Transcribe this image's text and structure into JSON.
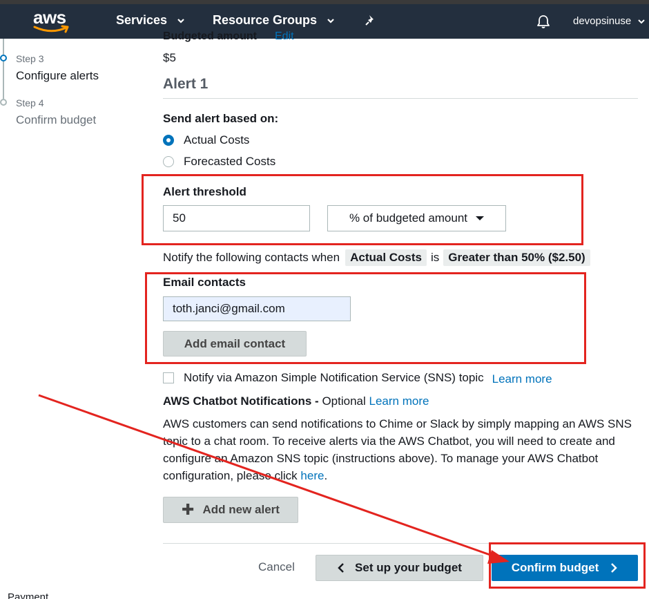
{
  "topnav": {
    "logo": "aws",
    "services_label": "Services",
    "resource_groups_label": "Resource Groups",
    "username": "devopsinuse",
    "icons": [
      "chevron-down-icon",
      "pin-icon",
      "bell-icon"
    ],
    "background_color": "#232f3e"
  },
  "steps": [
    {
      "label": "Step 3",
      "title": "Configure alerts",
      "state": "active"
    },
    {
      "label": "Step 4",
      "title": "Confirm budget",
      "state": "pending"
    }
  ],
  "sidebar_footer": "Payment",
  "budget": {
    "amount_label": "Budgeted amount",
    "edit_link": "Edit",
    "amount_value": "$5"
  },
  "alert": {
    "heading": "Alert 1",
    "send_based_on_label": "Send alert based on:",
    "options": [
      {
        "label": "Actual Costs",
        "checked": true
      },
      {
        "label": "Forecasted Costs",
        "checked": false
      }
    ],
    "threshold_label": "Alert threshold",
    "threshold_value": "50",
    "threshold_unit": "% of budgeted amount",
    "notify_prefix": "Notify the following contacts when",
    "notify_chip_1": "Actual Costs",
    "notify_mid": "is",
    "notify_chip_2": "Greater than 50% ($2.50)",
    "email_label": "Email contacts",
    "email_value": "toth.janci@gmail.com",
    "add_email_label": "Add email contact",
    "sns_label": "Notify via Amazon Simple Notification Service (SNS) topic",
    "sns_learn_more": "Learn more",
    "chatbot_title": "AWS Chatbot Notifications -",
    "chatbot_optional": "Optional",
    "chatbot_learn_more": "Learn more",
    "chatbot_text": "AWS customers can send notifications to Chime or Slack by simply mapping an AWS SNS topic to a chat room. To receive alerts via the AWS Chatbot, you will need to create and configure an Amazon SNS topic (instructions above). To manage your AWS Chatbot configuration, please click",
    "chatbot_here": "here",
    "chatbot_end": ".",
    "add_alert_label": "Add new alert"
  },
  "footer": {
    "cancel_label": "Cancel",
    "back_label": "Set up your budget",
    "confirm_label": "Confirm budget"
  },
  "colors": {
    "primary": "#0073bb",
    "annotation": "#e3241f",
    "input_autofill": "#e8f0fe"
  }
}
